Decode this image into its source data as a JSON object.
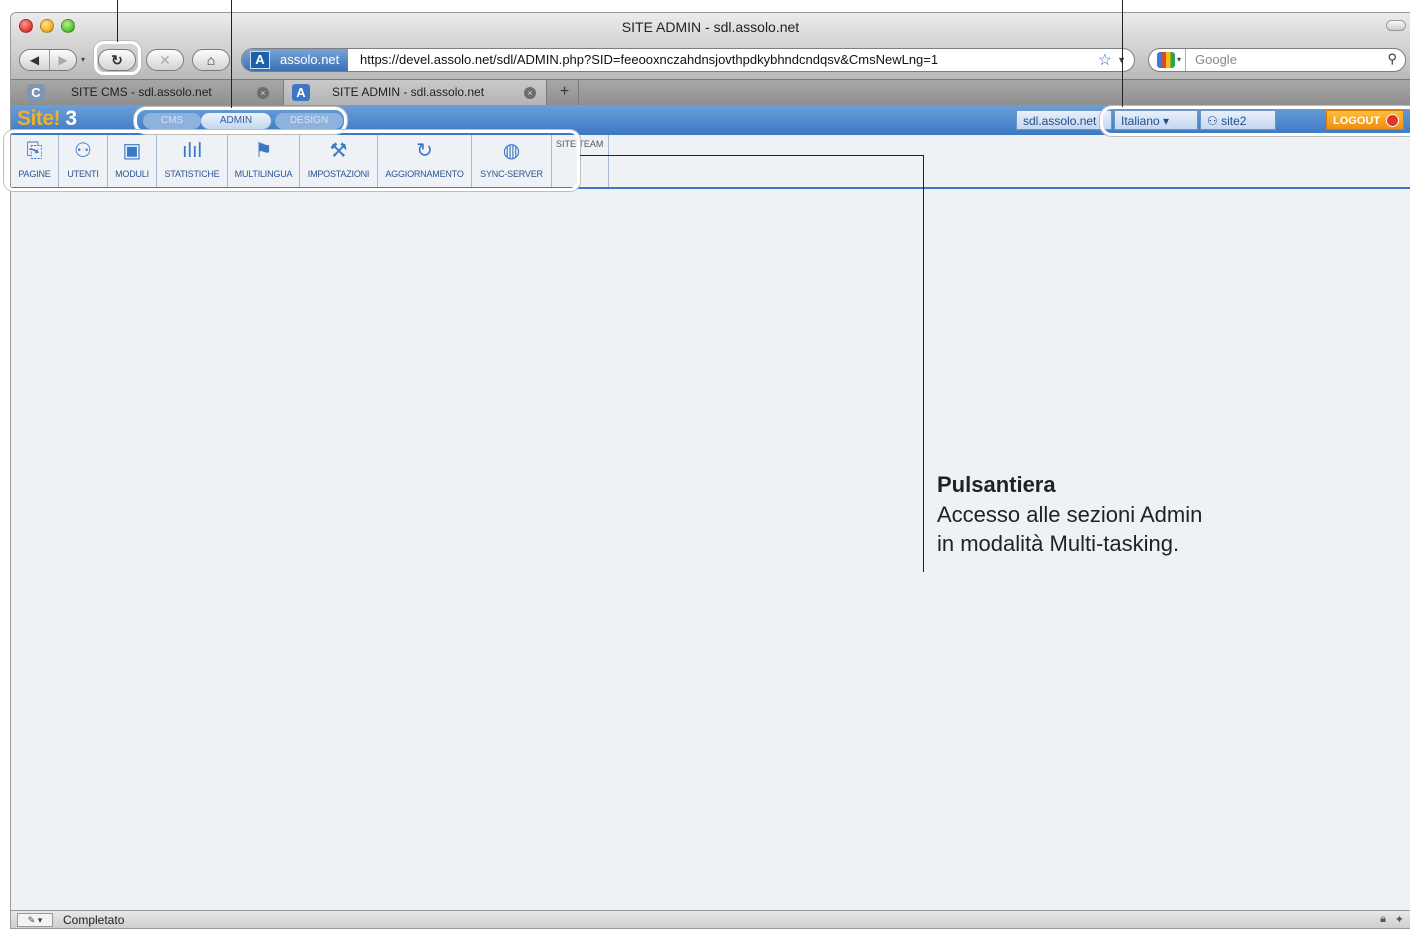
{
  "browser": {
    "window_title": "SITE ADMIN - sdl.assolo.net",
    "url_site_badge": "assolo.net",
    "url": "https://devel.assolo.net/sdl/ADMIN.php?SID=feeooxnczahdnsjovthpdkybhndcndqsv&CmsNewLng=1",
    "search_placeholder": "Google",
    "status_text": "Completato",
    "tabs": [
      {
        "favicon_letter": "C",
        "label": "SITE CMS - sdl.assolo.net"
      },
      {
        "favicon_letter": "A",
        "label": "SITE ADMIN - sdl.assolo.net"
      }
    ],
    "new_tab_glyph": "+"
  },
  "app": {
    "logo_text": "Site!",
    "logo_version": "3",
    "modes": [
      {
        "label": "CMS"
      },
      {
        "label": "ADMIN"
      },
      {
        "label": "DESIGN"
      }
    ],
    "domain": "sdl.assolo.net",
    "language": "Italiano",
    "user": "site2",
    "logout_label": "LOGOUT",
    "toolbar_items": [
      {
        "label": "PAGINE",
        "icon": "pages-icon"
      },
      {
        "label": "UTENTI",
        "icon": "users-icon"
      },
      {
        "label": "MODULI",
        "icon": "modules-icon"
      },
      {
        "label": "STATISTICHE",
        "icon": "statistics-icon"
      },
      {
        "label": "MULTILINGUA",
        "icon": "flag-icon"
      },
      {
        "label": "IMPOSTAZIONI",
        "icon": "tools-icon"
      },
      {
        "label": "AGGIORNAMENTO",
        "icon": "refresh-icon"
      },
      {
        "label": "SYNC-SERVER",
        "icon": "globe-icon"
      }
    ],
    "site_team_label": "SITE TEAM"
  },
  "annotation": {
    "title": "Pulsantiera",
    "body_line1": "Accesso alle sezioni Admin",
    "body_line2": "in modalità Multi-tasking."
  },
  "colors": {
    "app_header_blue": "#3c78c4",
    "logo_orange": "#f2b02a",
    "logout_orange": "#f08c10",
    "content_background": "#eef2f6"
  }
}
